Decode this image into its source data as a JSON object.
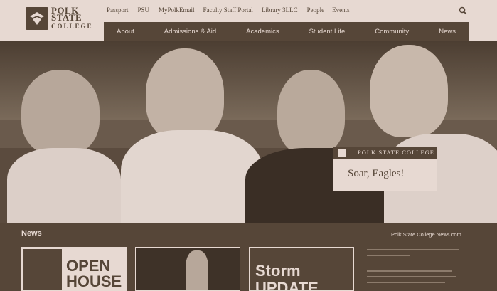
{
  "header": {
    "logo": {
      "line1": "POLK",
      "line2": "STATE",
      "line3": "COLLEGE"
    },
    "utility_links": [
      "Passport",
      "PSU",
      "MyPolkEmail",
      "Faculty Staff Portal",
      "Library 3LLC",
      "People",
      "Events"
    ],
    "search_icon": "search-icon"
  },
  "nav": {
    "items": [
      "About",
      "Admissions & Aid",
      "Academics",
      "Student Life",
      "Community",
      "News"
    ]
  },
  "hero": {
    "callout_bar": "POLK STATE COLLEGE",
    "callout_text": "Soar, Eagles!"
  },
  "news": {
    "heading": "News",
    "link": "Polk State College News.com",
    "cards": [
      {
        "line1": "OPEN",
        "line2": "HOUSE"
      },
      {
        "line1": "",
        "line2": ""
      },
      {
        "line1": "Storm",
        "line2": "UPDATE"
      }
    ]
  },
  "colors": {
    "dark": "#564638",
    "light": "#e7d9d2"
  }
}
